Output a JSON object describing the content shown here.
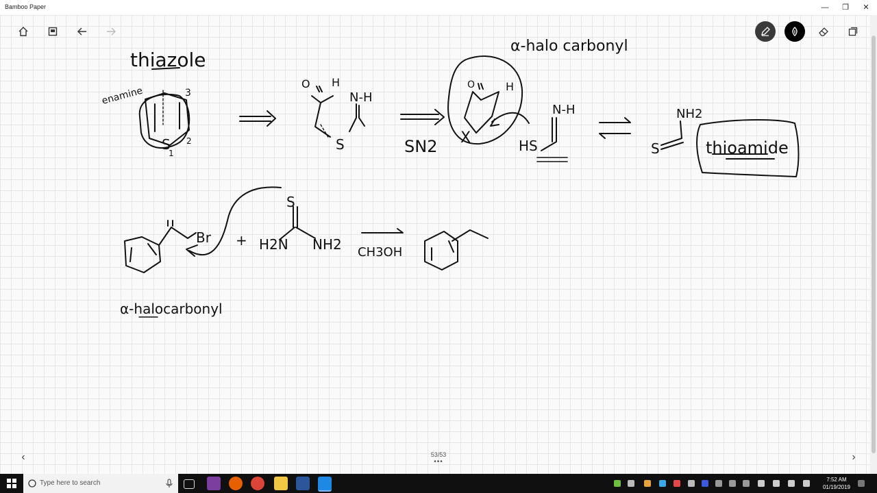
{
  "window": {
    "title": "Bamboo Paper"
  },
  "toolbar": {
    "left": [
      "home-icon",
      "page-icon",
      "undo-icon",
      "redo-icon"
    ],
    "right": [
      "pen-tool-icon",
      "brush-tool-icon",
      "eraser-icon",
      "copy-icon"
    ]
  },
  "drawing": {
    "thiazole": "thiazole",
    "enamine": "enamine",
    "num3": "3",
    "num2": "2",
    "num1": "1",
    "S": "S",
    "H": "H",
    "NH": "N-H",
    "O": "O",
    "X": "X",
    "HS": "HS",
    "SN2": "SN2",
    "alpha_halo_top": "α-halo carbonyl",
    "NH2": "NH2",
    "thioamide": "thioamide",
    "Br": "Br",
    "plus": "+",
    "H2N": "H2N",
    "CH3OH": "CH3OH",
    "alpha_halo_bottom": "α-halocarbonyl"
  },
  "pager": {
    "indicator": "53/53",
    "dots": "•••"
  },
  "taskbar": {
    "search_placeholder": "Type here to search",
    "time": "7:52 AM",
    "date": "01/19/2019"
  }
}
